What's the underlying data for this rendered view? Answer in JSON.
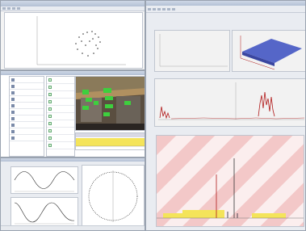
{
  "windows": {
    "top_left": {
      "title": ""
    },
    "right": {
      "title": ""
    },
    "middle_left": {
      "title": ""
    },
    "bottom_left": {
      "title": ""
    }
  },
  "colors": {
    "title_blue": "#b3c0d4",
    "accent_red": "#b01818",
    "surface_blue": "#5566c8",
    "yellow_bar": "#f4e45a",
    "green_tag": "#3ecf3e",
    "pink_pattern": "#f3c8c8"
  },
  "icons": [
    "window-icon",
    "toolbar-button-icon",
    "tree-item-icon",
    "checkbox-icon"
  ]
}
